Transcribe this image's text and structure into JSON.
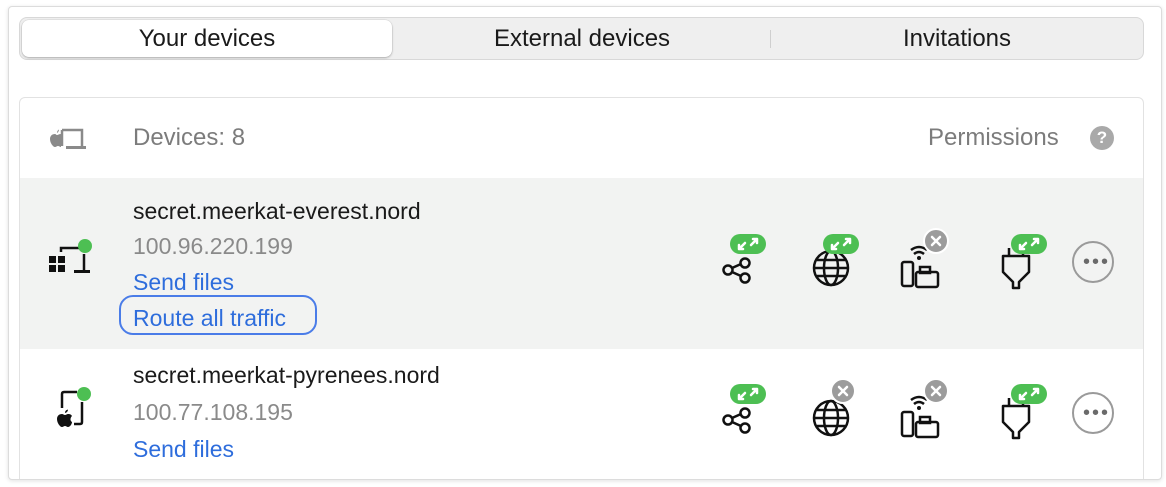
{
  "tabs": [
    {
      "label": "Your devices",
      "selected": true
    },
    {
      "label": "External devices",
      "selected": false
    },
    {
      "label": "Invitations",
      "selected": false
    }
  ],
  "header": {
    "icon": "apple-laptop-icon",
    "devices_count": "Devices: 8",
    "permissions_label": "Permissions",
    "help_label": "?"
  },
  "devices": [
    {
      "name": "secret.meerkat-everest.nord",
      "ip": "100.96.220.199",
      "icon": "windows-desktop-online-icon",
      "online": true,
      "actions": [
        "Send files",
        "Route all traffic"
      ],
      "permissions": {
        "file-sharing": "enabled",
        "internet-traffic-routing": "enabled",
        "local-network-access": "disabled",
        "remote-access": "enabled"
      }
    },
    {
      "name": "secret.meerkat-pyrenees.nord",
      "ip": "100.77.108.195",
      "icon": "apple-tablet-online-icon",
      "online": true,
      "actions": [
        "Send files"
      ],
      "permissions": {
        "file-sharing": "enabled",
        "internet-traffic-routing": "disabled",
        "local-network-access": "disabled",
        "remote-access": "enabled"
      }
    }
  ],
  "colors": {
    "link": "#2e6ddc",
    "enabled_badge": "#4dbf53",
    "disabled_badge": "#9c9c9c",
    "online_dot": "#4dbf53",
    "focus_ring": "#4a7ce8"
  }
}
